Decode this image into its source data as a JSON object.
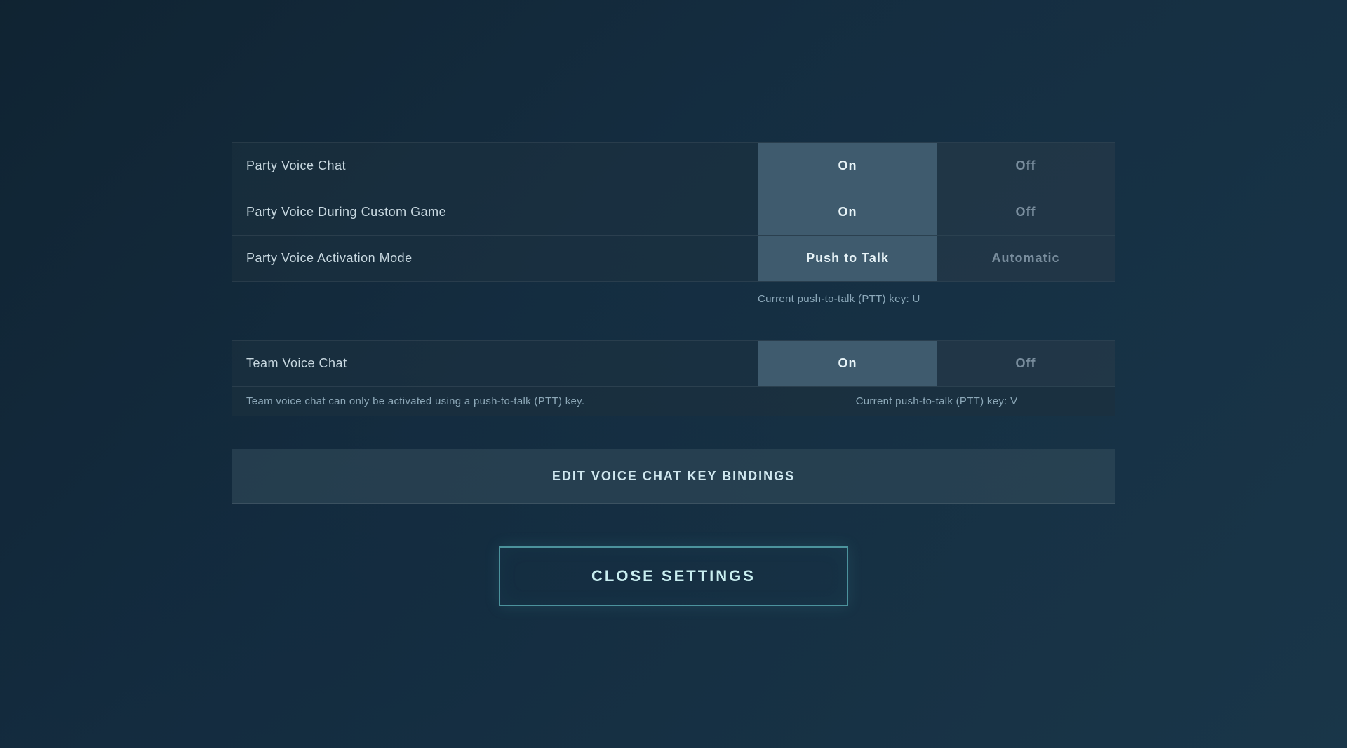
{
  "settings": {
    "party_voice_chat": {
      "label": "Party Voice Chat",
      "on_label": "On",
      "off_label": "Off",
      "active": "on"
    },
    "party_voice_custom_game": {
      "label": "Party Voice During Custom Game",
      "on_label": "On",
      "off_label": "Off",
      "active": "on"
    },
    "party_voice_activation": {
      "label": "Party Voice Activation Mode",
      "push_to_talk_label": "Push to Talk",
      "automatic_label": "Automatic",
      "active": "push_to_talk"
    },
    "ptt_hint": "Current push-to-talk (PTT) key: U",
    "team_voice_chat": {
      "label": "Team Voice Chat",
      "on_label": "On",
      "off_label": "Off",
      "active": "on"
    },
    "team_note_left": "Team voice chat can only be activated using a push-to-talk (PTT) key.",
    "team_note_right": "Current push-to-talk (PTT) key: V",
    "edit_keybindings_label": "EDIT VOICE CHAT KEY BINDINGS",
    "close_settings_label": "CLOSE SETTINGS"
  }
}
